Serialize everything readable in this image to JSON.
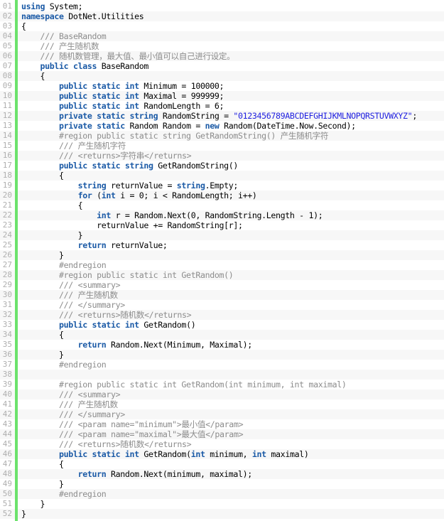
{
  "editor": {
    "language": "C#",
    "colors": {
      "keyword": "#1b5aa6",
      "comment": "#8c8c8c",
      "string": "#1f1fe0",
      "plain": "#000000",
      "line_number": "#afafaf",
      "gutter_bar": "#6ce26c",
      "alt_row": "#f7f7f7"
    },
    "lines": [
      {
        "n": "01",
        "indent": 0,
        "tokens": [
          [
            "kw",
            "using"
          ],
          [
            "p",
            " System;"
          ]
        ]
      },
      {
        "n": "02",
        "indent": 0,
        "tokens": [
          [
            "kw",
            "namespace"
          ],
          [
            "p",
            " DotNet.Utilities"
          ]
        ]
      },
      {
        "n": "03",
        "indent": 0,
        "tokens": [
          [
            "p",
            "{"
          ]
        ]
      },
      {
        "n": "04",
        "indent": 1,
        "tokens": [
          [
            "cm",
            "/// BaseRandom"
          ]
        ]
      },
      {
        "n": "05",
        "indent": 1,
        "tokens": [
          [
            "cm",
            "/// 产生随机数"
          ]
        ]
      },
      {
        "n": "06",
        "indent": 1,
        "tokens": [
          [
            "cm",
            "/// 随机数管理，最大值、最小值可以自己进行设定。"
          ]
        ]
      },
      {
        "n": "07",
        "indent": 1,
        "tokens": [
          [
            "kw",
            "public class"
          ],
          [
            "p",
            " BaseRandom"
          ]
        ]
      },
      {
        "n": "08",
        "indent": 1,
        "tokens": [
          [
            "p",
            "{"
          ]
        ]
      },
      {
        "n": "09",
        "indent": 2,
        "tokens": [
          [
            "kw",
            "public static int"
          ],
          [
            "p",
            " Minimum = 100000;"
          ]
        ]
      },
      {
        "n": "10",
        "indent": 2,
        "tokens": [
          [
            "kw",
            "public static int"
          ],
          [
            "p",
            " Maximal = 999999;"
          ]
        ]
      },
      {
        "n": "11",
        "indent": 2,
        "tokens": [
          [
            "kw",
            "public static int"
          ],
          [
            "p",
            " RandomLength = 6;"
          ]
        ]
      },
      {
        "n": "12",
        "indent": 2,
        "tokens": [
          [
            "kw",
            "private static string"
          ],
          [
            "p",
            " RandomString = "
          ],
          [
            "st",
            "\"0123456789ABCDEFGHIJKMLNOPQRSTUVWXYZ\""
          ],
          [
            "p",
            ";"
          ]
        ]
      },
      {
        "n": "13",
        "indent": 2,
        "tokens": [
          [
            "kw",
            "private static"
          ],
          [
            "p",
            " Random Random = "
          ],
          [
            "kw",
            "new"
          ],
          [
            "p",
            " Random(DateTime.Now.Second);"
          ]
        ]
      },
      {
        "n": "14",
        "indent": 2,
        "tokens": [
          [
            "cm",
            "#region public static string GetRandomString() 产生随机字符"
          ]
        ]
      },
      {
        "n": "15",
        "indent": 2,
        "tokens": [
          [
            "cm",
            "/// 产生随机字符"
          ]
        ]
      },
      {
        "n": "16",
        "indent": 2,
        "tokens": [
          [
            "cm",
            "/// <returns>字符串</returns>"
          ]
        ]
      },
      {
        "n": "17",
        "indent": 2,
        "tokens": [
          [
            "kw",
            "public static string"
          ],
          [
            "p",
            " GetRandomString()"
          ]
        ]
      },
      {
        "n": "18",
        "indent": 2,
        "tokens": [
          [
            "p",
            "{"
          ]
        ]
      },
      {
        "n": "19",
        "indent": 3,
        "tokens": [
          [
            "kw",
            "string"
          ],
          [
            "p",
            " returnValue = "
          ],
          [
            "kw",
            "string"
          ],
          [
            "p",
            ".Empty;"
          ]
        ]
      },
      {
        "n": "20",
        "indent": 3,
        "tokens": [
          [
            "kw",
            "for"
          ],
          [
            "p",
            " ("
          ],
          [
            "kw",
            "int"
          ],
          [
            "p",
            " i = 0; i < RandomLength; i++)"
          ]
        ]
      },
      {
        "n": "21",
        "indent": 3,
        "tokens": [
          [
            "p",
            "{"
          ]
        ]
      },
      {
        "n": "22",
        "indent": 4,
        "tokens": [
          [
            "kw",
            "int"
          ],
          [
            "p",
            " r = Random.Next(0, RandomString.Length - 1);"
          ]
        ]
      },
      {
        "n": "23",
        "indent": 4,
        "tokens": [
          [
            "p",
            "returnValue += RandomString[r];"
          ]
        ]
      },
      {
        "n": "24",
        "indent": 3,
        "tokens": [
          [
            "p",
            "}"
          ]
        ]
      },
      {
        "n": "25",
        "indent": 3,
        "tokens": [
          [
            "kw",
            "return"
          ],
          [
            "p",
            " returnValue;"
          ]
        ]
      },
      {
        "n": "26",
        "indent": 2,
        "tokens": [
          [
            "p",
            "}"
          ]
        ]
      },
      {
        "n": "27",
        "indent": 2,
        "tokens": [
          [
            "cm",
            "#endregion"
          ]
        ]
      },
      {
        "n": "28",
        "indent": 2,
        "tokens": [
          [
            "cm",
            "#region public static int GetRandom()"
          ]
        ]
      },
      {
        "n": "29",
        "indent": 2,
        "tokens": [
          [
            "cm",
            "/// <summary>"
          ]
        ]
      },
      {
        "n": "30",
        "indent": 2,
        "tokens": [
          [
            "cm",
            "/// 产生随机数"
          ]
        ]
      },
      {
        "n": "31",
        "indent": 2,
        "tokens": [
          [
            "cm",
            "/// </summary>"
          ]
        ]
      },
      {
        "n": "32",
        "indent": 2,
        "tokens": [
          [
            "cm",
            "/// <returns>随机数</returns>"
          ]
        ]
      },
      {
        "n": "33",
        "indent": 2,
        "tokens": [
          [
            "kw",
            "public static int"
          ],
          [
            "p",
            " GetRandom()"
          ]
        ]
      },
      {
        "n": "34",
        "indent": 2,
        "tokens": [
          [
            "p",
            "{"
          ]
        ]
      },
      {
        "n": "35",
        "indent": 3,
        "tokens": [
          [
            "kw",
            "return"
          ],
          [
            "p",
            " Random.Next(Minimum, Maximal);"
          ]
        ]
      },
      {
        "n": "36",
        "indent": 2,
        "tokens": [
          [
            "p",
            "}"
          ]
        ]
      },
      {
        "n": "37",
        "indent": 2,
        "tokens": [
          [
            "cm",
            "#endregion"
          ]
        ]
      },
      {
        "n": "38",
        "indent": 0,
        "tokens": []
      },
      {
        "n": "39",
        "indent": 2,
        "tokens": [
          [
            "cm",
            "#region public static int GetRandom(int minimum, int maximal)"
          ]
        ]
      },
      {
        "n": "40",
        "indent": 2,
        "tokens": [
          [
            "cm",
            "/// <summary>"
          ]
        ]
      },
      {
        "n": "41",
        "indent": 2,
        "tokens": [
          [
            "cm",
            "/// 产生随机数"
          ]
        ]
      },
      {
        "n": "42",
        "indent": 2,
        "tokens": [
          [
            "cm",
            "/// </summary>"
          ]
        ]
      },
      {
        "n": "43",
        "indent": 2,
        "tokens": [
          [
            "cm",
            "/// <param name=\"minimum\">最小值</param>"
          ]
        ]
      },
      {
        "n": "44",
        "indent": 2,
        "tokens": [
          [
            "cm",
            "/// <param name=\"maximal\">最大值</param>"
          ]
        ]
      },
      {
        "n": "45",
        "indent": 2,
        "tokens": [
          [
            "cm",
            "/// <returns>随机数</returns>"
          ]
        ]
      },
      {
        "n": "46",
        "indent": 2,
        "tokens": [
          [
            "kw",
            "public static int"
          ],
          [
            "p",
            " GetRandom("
          ],
          [
            "kw",
            "int"
          ],
          [
            "p",
            " minimum, "
          ],
          [
            "kw",
            "int"
          ],
          [
            "p",
            " maximal)"
          ]
        ]
      },
      {
        "n": "47",
        "indent": 2,
        "tokens": [
          [
            "p",
            "{"
          ]
        ]
      },
      {
        "n": "48",
        "indent": 3,
        "tokens": [
          [
            "kw",
            "return"
          ],
          [
            "p",
            " Random.Next(minimum, maximal);"
          ]
        ]
      },
      {
        "n": "49",
        "indent": 2,
        "tokens": [
          [
            "p",
            "}"
          ]
        ]
      },
      {
        "n": "50",
        "indent": 2,
        "tokens": [
          [
            "cm",
            "#endregion"
          ]
        ]
      },
      {
        "n": "51",
        "indent": 1,
        "tokens": [
          [
            "p",
            "}"
          ]
        ]
      },
      {
        "n": "52",
        "indent": 0,
        "tokens": [
          [
            "p",
            "}"
          ]
        ]
      }
    ]
  }
}
